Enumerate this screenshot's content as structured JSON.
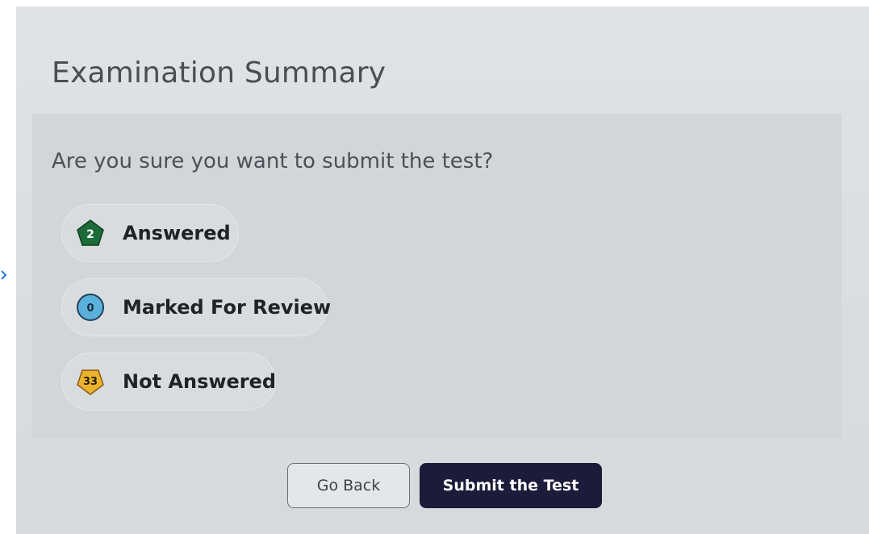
{
  "summary": {
    "title": "Examination Summary",
    "question": "Are you sure you want to submit the test?"
  },
  "statuses": [
    {
      "label": "Answered",
      "count": "2",
      "shape": "pentagon",
      "color": "#1e6b3a"
    },
    {
      "label": "Marked For Review",
      "count": "0",
      "shape": "circle",
      "color": "#5ab1dc"
    },
    {
      "label": "Not Answered",
      "count": "33",
      "shape": "pentagon-inverted",
      "color": "#e9b32e"
    }
  ],
  "buttons": {
    "go_back": "Go Back",
    "submit": "Submit the Test"
  },
  "colors": {
    "submit_bg": "#1c1b3a",
    "answered": "#1e6b3a",
    "review": "#5ab1dc",
    "not_answered": "#e9b32e"
  }
}
